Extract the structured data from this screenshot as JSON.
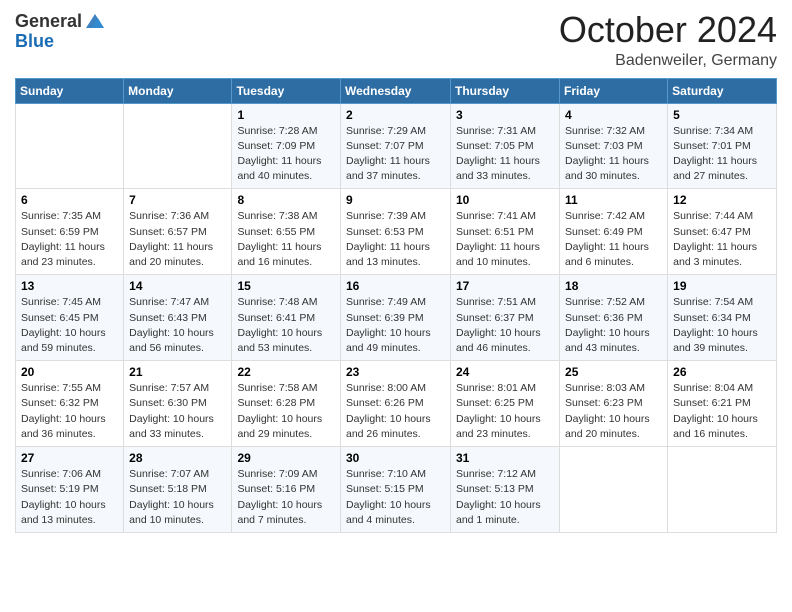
{
  "header": {
    "logo_general": "General",
    "logo_blue": "Blue",
    "month": "October 2024",
    "location": "Badenweiler, Germany"
  },
  "weekdays": [
    "Sunday",
    "Monday",
    "Tuesday",
    "Wednesday",
    "Thursday",
    "Friday",
    "Saturday"
  ],
  "weeks": [
    [
      {
        "day": "",
        "info": ""
      },
      {
        "day": "",
        "info": ""
      },
      {
        "day": "1",
        "info": "Sunrise: 7:28 AM\nSunset: 7:09 PM\nDaylight: 11 hours and 40 minutes."
      },
      {
        "day": "2",
        "info": "Sunrise: 7:29 AM\nSunset: 7:07 PM\nDaylight: 11 hours and 37 minutes."
      },
      {
        "day": "3",
        "info": "Sunrise: 7:31 AM\nSunset: 7:05 PM\nDaylight: 11 hours and 33 minutes."
      },
      {
        "day": "4",
        "info": "Sunrise: 7:32 AM\nSunset: 7:03 PM\nDaylight: 11 hours and 30 minutes."
      },
      {
        "day": "5",
        "info": "Sunrise: 7:34 AM\nSunset: 7:01 PM\nDaylight: 11 hours and 27 minutes."
      }
    ],
    [
      {
        "day": "6",
        "info": "Sunrise: 7:35 AM\nSunset: 6:59 PM\nDaylight: 11 hours and 23 minutes."
      },
      {
        "day": "7",
        "info": "Sunrise: 7:36 AM\nSunset: 6:57 PM\nDaylight: 11 hours and 20 minutes."
      },
      {
        "day": "8",
        "info": "Sunrise: 7:38 AM\nSunset: 6:55 PM\nDaylight: 11 hours and 16 minutes."
      },
      {
        "day": "9",
        "info": "Sunrise: 7:39 AM\nSunset: 6:53 PM\nDaylight: 11 hours and 13 minutes."
      },
      {
        "day": "10",
        "info": "Sunrise: 7:41 AM\nSunset: 6:51 PM\nDaylight: 11 hours and 10 minutes."
      },
      {
        "day": "11",
        "info": "Sunrise: 7:42 AM\nSunset: 6:49 PM\nDaylight: 11 hours and 6 minutes."
      },
      {
        "day": "12",
        "info": "Sunrise: 7:44 AM\nSunset: 6:47 PM\nDaylight: 11 hours and 3 minutes."
      }
    ],
    [
      {
        "day": "13",
        "info": "Sunrise: 7:45 AM\nSunset: 6:45 PM\nDaylight: 10 hours and 59 minutes."
      },
      {
        "day": "14",
        "info": "Sunrise: 7:47 AM\nSunset: 6:43 PM\nDaylight: 10 hours and 56 minutes."
      },
      {
        "day": "15",
        "info": "Sunrise: 7:48 AM\nSunset: 6:41 PM\nDaylight: 10 hours and 53 minutes."
      },
      {
        "day": "16",
        "info": "Sunrise: 7:49 AM\nSunset: 6:39 PM\nDaylight: 10 hours and 49 minutes."
      },
      {
        "day": "17",
        "info": "Sunrise: 7:51 AM\nSunset: 6:37 PM\nDaylight: 10 hours and 46 minutes."
      },
      {
        "day": "18",
        "info": "Sunrise: 7:52 AM\nSunset: 6:36 PM\nDaylight: 10 hours and 43 minutes."
      },
      {
        "day": "19",
        "info": "Sunrise: 7:54 AM\nSunset: 6:34 PM\nDaylight: 10 hours and 39 minutes."
      }
    ],
    [
      {
        "day": "20",
        "info": "Sunrise: 7:55 AM\nSunset: 6:32 PM\nDaylight: 10 hours and 36 minutes."
      },
      {
        "day": "21",
        "info": "Sunrise: 7:57 AM\nSunset: 6:30 PM\nDaylight: 10 hours and 33 minutes."
      },
      {
        "day": "22",
        "info": "Sunrise: 7:58 AM\nSunset: 6:28 PM\nDaylight: 10 hours and 29 minutes."
      },
      {
        "day": "23",
        "info": "Sunrise: 8:00 AM\nSunset: 6:26 PM\nDaylight: 10 hours and 26 minutes."
      },
      {
        "day": "24",
        "info": "Sunrise: 8:01 AM\nSunset: 6:25 PM\nDaylight: 10 hours and 23 minutes."
      },
      {
        "day": "25",
        "info": "Sunrise: 8:03 AM\nSunset: 6:23 PM\nDaylight: 10 hours and 20 minutes."
      },
      {
        "day": "26",
        "info": "Sunrise: 8:04 AM\nSunset: 6:21 PM\nDaylight: 10 hours and 16 minutes."
      }
    ],
    [
      {
        "day": "27",
        "info": "Sunrise: 7:06 AM\nSunset: 5:19 PM\nDaylight: 10 hours and 13 minutes."
      },
      {
        "day": "28",
        "info": "Sunrise: 7:07 AM\nSunset: 5:18 PM\nDaylight: 10 hours and 10 minutes."
      },
      {
        "day": "29",
        "info": "Sunrise: 7:09 AM\nSunset: 5:16 PM\nDaylight: 10 hours and 7 minutes."
      },
      {
        "day": "30",
        "info": "Sunrise: 7:10 AM\nSunset: 5:15 PM\nDaylight: 10 hours and 4 minutes."
      },
      {
        "day": "31",
        "info": "Sunrise: 7:12 AM\nSunset: 5:13 PM\nDaylight: 10 hours and 1 minute."
      },
      {
        "day": "",
        "info": ""
      },
      {
        "day": "",
        "info": ""
      }
    ]
  ]
}
